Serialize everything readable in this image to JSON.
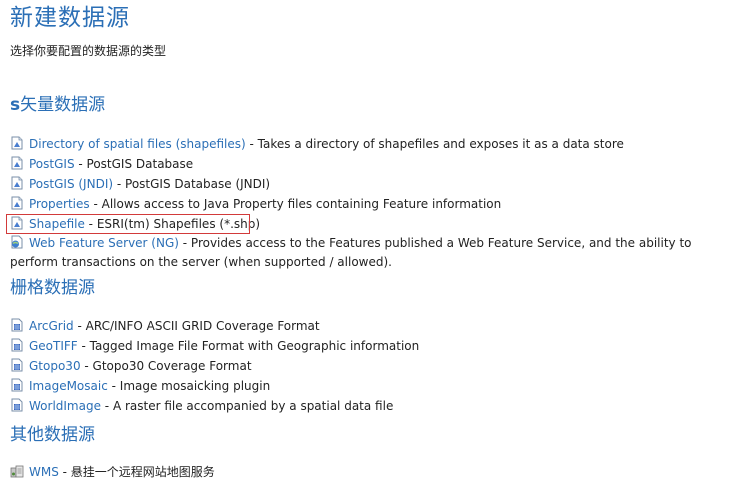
{
  "page": {
    "title": "新建数据源",
    "subtitle": "选择你要配置的数据源的类型"
  },
  "sections": {
    "vector": {
      "prefix": "s",
      "title": "矢量数据源",
      "items": [
        {
          "link": "Directory of spatial files (shapefiles)",
          "desc": " - Takes a directory of shapefiles and exposes it as a data store",
          "icon": "vector-store-icon"
        },
        {
          "link": "PostGIS",
          "desc": " - PostGIS Database",
          "icon": "vector-store-icon"
        },
        {
          "link": "PostGIS (JNDI)",
          "desc": " - PostGIS Database (JNDI)",
          "icon": "vector-store-icon"
        },
        {
          "link": "Properties",
          "desc": " - Allows access to Java Property files containing Feature information",
          "icon": "vector-store-icon"
        },
        {
          "link": "Shapefile",
          "desc": " - ESRI(tm) Shapefiles (*.shp)",
          "icon": "vector-store-icon",
          "highlighted": true
        },
        {
          "link": "Web Feature Server (NG)",
          "desc": " - Provides access to the Features published a Web Feature Service, and the ability to perform transactions on the server (when supported / allowed).",
          "icon": "wfs-store-icon"
        }
      ]
    },
    "raster": {
      "title": "栅格数据源",
      "items": [
        {
          "link": "ArcGrid",
          "desc": " - ARC/INFO ASCII GRID Coverage Format",
          "icon": "raster-store-icon"
        },
        {
          "link": "GeoTIFF",
          "desc": " - Tagged Image File Format with Geographic information",
          "icon": "raster-store-icon"
        },
        {
          "link": "Gtopo30",
          "desc": " - Gtopo30 Coverage Format",
          "icon": "raster-store-icon"
        },
        {
          "link": "ImageMosaic",
          "desc": " - Image mosaicking plugin",
          "icon": "raster-store-icon"
        },
        {
          "link": "WorldImage",
          "desc": " - A raster file accompanied by a spatial data file",
          "icon": "raster-store-icon"
        }
      ]
    },
    "other": {
      "title": "其他数据源",
      "items": [
        {
          "link": "WMS",
          "desc": " - 悬挂一个远程网站地图服务",
          "icon": "wms-store-icon"
        }
      ]
    }
  },
  "colors": {
    "link": "#2b6fb6",
    "title": "#2b6fb6",
    "highlight_border": "#d23a3a"
  }
}
